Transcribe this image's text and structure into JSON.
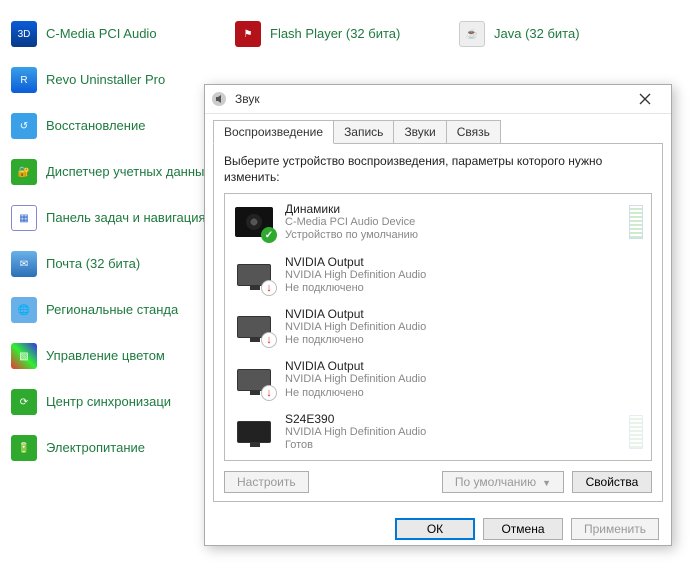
{
  "cp_items": {
    "row1_col1": "C-Media PCI Audio",
    "row1_col2": "Flash Player (32 бита)",
    "row1_col3": "Java (32 бита)",
    "row2_col1": "Revo Uninstaller Pro",
    "row3_col1": "Восстановление",
    "row4_col1": "Диспетчер учетных данных",
    "row5_col1": "Панель задач и навигация",
    "row6_col1": "Почта (32 бита)",
    "row7_col1": "Региональные станда",
    "row8_col1": "Управление цветом",
    "row9_col1": "Центр синхронизаци",
    "row10_col1": "Электропитание"
  },
  "dialog": {
    "title": "Звук",
    "tabs": {
      "playback": "Воспроизведение",
      "record": "Запись",
      "sounds": "Звуки",
      "comm": "Связь"
    },
    "instruction": "Выберите устройство воспроизведения, параметры которого нужно изменить:",
    "devices": [
      {
        "name": "Динамики",
        "sub1": "C-Media PCI Audio Device",
        "sub2": "Устройство по умолчанию",
        "icon": "speaker",
        "badge": "green",
        "meter": true
      },
      {
        "name": "NVIDIA Output",
        "sub1": "NVIDIA High Definition Audio",
        "sub2": "Не подключено",
        "icon": "monitor",
        "badge": "red",
        "meter": false
      },
      {
        "name": "NVIDIA Output",
        "sub1": "NVIDIA High Definition Audio",
        "sub2": "Не подключено",
        "icon": "monitor",
        "badge": "red",
        "meter": false
      },
      {
        "name": "NVIDIA Output",
        "sub1": "NVIDIA High Definition Audio",
        "sub2": "Не подключено",
        "icon": "monitor",
        "badge": "red",
        "meter": false
      },
      {
        "name": "S24E390",
        "sub1": "NVIDIA High Definition Audio",
        "sub2": "Готов",
        "icon": "monitor-dark",
        "badge": "none",
        "meter": true
      }
    ],
    "buttons": {
      "configure": "Настроить",
      "default": "По умолчанию",
      "properties": "Свойства",
      "ok": "ОК",
      "cancel": "Отмена",
      "apply": "Применить"
    }
  }
}
